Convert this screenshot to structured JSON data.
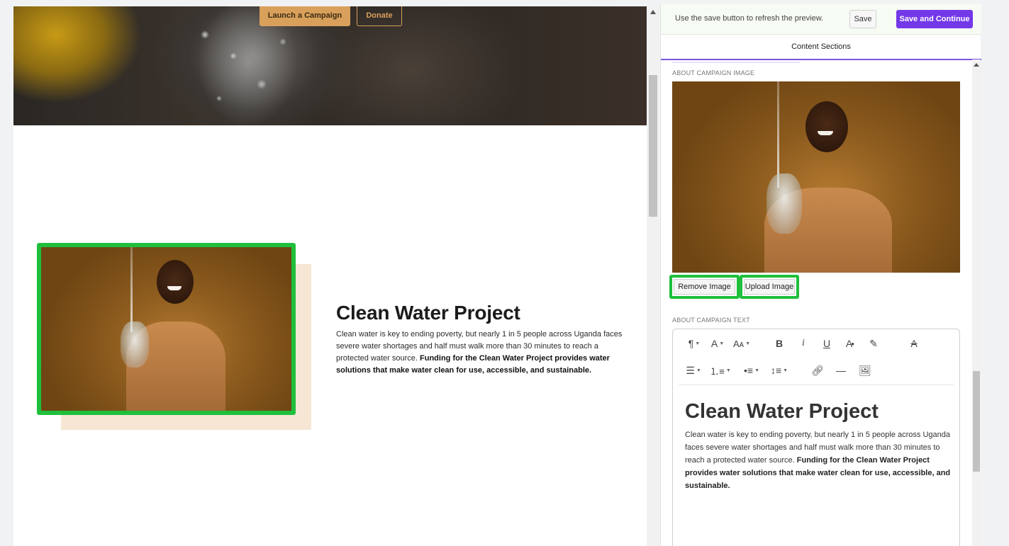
{
  "preview": {
    "hero": {
      "launch_label": "Launch a Campaign",
      "donate_label": "Donate"
    },
    "about": {
      "title": "Clean Water Project",
      "text_plain": "Clean water is key to ending poverty, but nearly 1 in 5 people across Uganda faces severe water shortages and half must walk more than 30 minutes to reach a protected water source. ",
      "text_bold": "Funding for the Clean Water Project provides water solutions that make water clean for use, accessible, and sustainable."
    }
  },
  "panel": {
    "notice": "Use the save button to refresh the preview.",
    "save_label": "Save",
    "save_continue_label": "Save and Continue",
    "tab_label": "Content Sections",
    "image_section_label": "ABOUT CAMPAIGN IMAGE",
    "remove_image_label": "Remove Image",
    "upload_image_label": "Upload Image",
    "text_section_label": "ABOUT CAMPAIGN TEXT",
    "editor": {
      "title": "Clean Water Project",
      "text_plain": "Clean water is key to ending poverty, but nearly 1 in 5 people across Uganda faces severe water shortages and half must walk more than 30 minutes to reach a protected water source. ",
      "text_bold": "Funding for the Clean Water Project provides water solutions that make water clean for use, accessible, and sustainable."
    },
    "toolbar_icons": {
      "paragraph": "paragraph-icon",
      "font": "font-family-icon",
      "font_size": "font-size-icon",
      "bold": "bold-icon",
      "italic": "italic-icon",
      "underline": "underline-icon",
      "text_color": "text-color-icon",
      "highlight": "highlight-icon",
      "clear_format": "clear-format-icon",
      "align": "align-icon",
      "ordered_list": "ordered-list-icon",
      "bullet_list": "bullet-list-icon",
      "line_height": "line-height-icon",
      "link": "link-icon",
      "horizontal_rule": "horizontal-rule-icon",
      "insert_image": "insert-image-icon"
    }
  },
  "colors": {
    "accent": "#7338e8",
    "highlight_green": "#1fbf3c",
    "hero_button": "#d9a05b"
  }
}
